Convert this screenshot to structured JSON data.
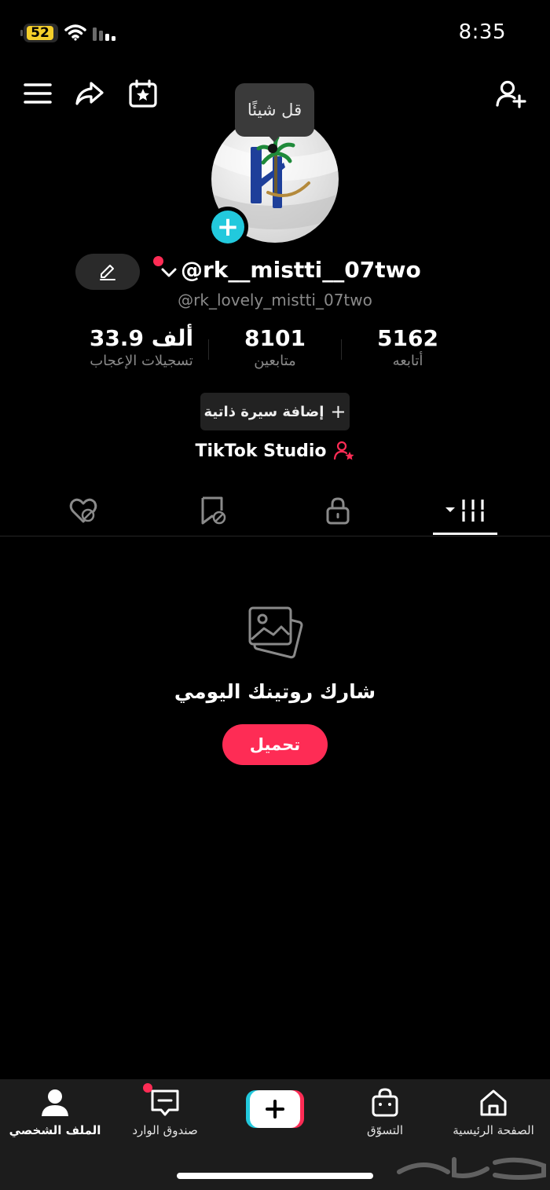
{
  "status_bar": {
    "battery_level": "52",
    "time": "8:35"
  },
  "tooltip": {
    "text": "قل شيئًا"
  },
  "profile": {
    "username": "@rk__mistti__07two",
    "handle": "@rk_lovely_mistti_07two"
  },
  "stats": [
    {
      "value": "5162",
      "label": "أتابعه"
    },
    {
      "value": "8101",
      "label": "متابعين"
    },
    {
      "value": "33.9 ألف",
      "label": "تسجيلات الإعجاب"
    }
  ],
  "bio_button": {
    "label": "إضافة سيرة ذاتية"
  },
  "studio": {
    "label": "TikTok Studio"
  },
  "empty_state": {
    "title": "شارك روتينك اليومي",
    "button": "تحميل"
  },
  "bottom_nav": {
    "home": "الصفحة الرئيسية",
    "shop": "التسوّق",
    "inbox": "صندوق الوارد",
    "profile": "الملف الشخصي"
  },
  "colors": {
    "accent": "#fe2c55",
    "cyan": "#22c9dd",
    "background": "#000000",
    "nav_background": "#1c1c1c"
  },
  "icons": [
    "menu-icon",
    "share-icon",
    "calendar-star-icon",
    "add-friend-icon",
    "pencil-icon",
    "chevron-down-icon",
    "studio-person-star-icon",
    "videos-grid-icon",
    "lock-icon",
    "favorites-icon",
    "liked-icon",
    "photo-icon",
    "home-icon",
    "shop-bag-icon",
    "plus-icon",
    "inbox-icon",
    "profile-icon"
  ]
}
